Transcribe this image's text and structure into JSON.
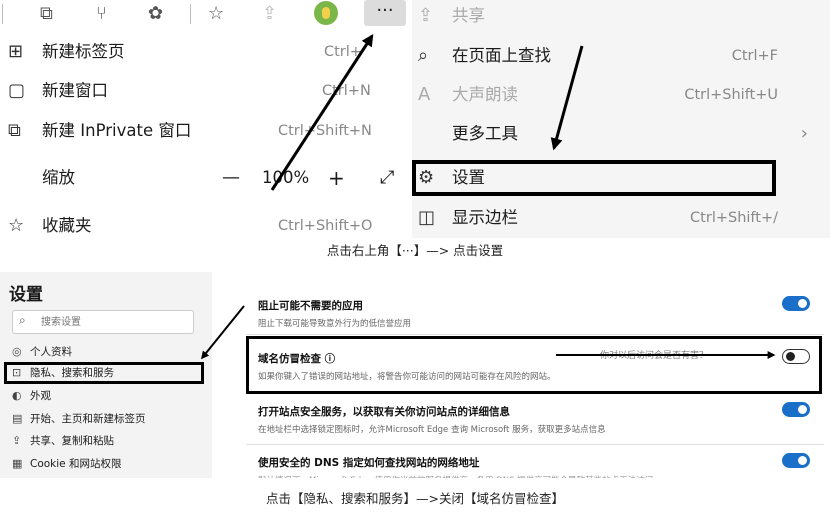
{
  "menu_left": {
    "items": [
      {
        "icon": "new-tab-icon",
        "glyph": "⊞",
        "label": "新建标签页",
        "shortcut": "Ctrl+"
      },
      {
        "icon": "new-window-icon",
        "glyph": "▢",
        "label": "新建窗口",
        "shortcut": "Ctrl+N"
      },
      {
        "icon": "inprivate-icon",
        "glyph": "⧉",
        "label": "新建 InPrivate 窗口",
        "shortcut": "Ctrl+Shift+N"
      },
      {
        "icon": "",
        "glyph": "",
        "label": "缩放",
        "shortcut": ""
      },
      {
        "icon": "favorites-icon",
        "glyph": "☆",
        "label": "收藏夹",
        "shortcut": "Ctrl+Shift+O"
      }
    ],
    "zoom": {
      "minus": "—",
      "value": "100%",
      "plus": "+",
      "expand": "⤢"
    }
  },
  "toolbar": {
    "more": "···"
  },
  "menu_right": {
    "items": [
      {
        "icon": "share-icon",
        "glyph": "⇪",
        "label": "共享",
        "shortcut": ""
      },
      {
        "icon": "find-icon",
        "glyph": "⌕",
        "label": "在页面上查找",
        "shortcut": "Ctrl+F"
      },
      {
        "icon": "read-aloud-icon",
        "glyph": "A",
        "label": "大声朗读",
        "shortcut": "Ctrl+Shift+U"
      },
      {
        "icon": "",
        "glyph": "",
        "label": "更多工具",
        "shortcut": "›"
      },
      {
        "icon": "settings-gear-icon",
        "glyph": "⚙",
        "label": "设置",
        "shortcut": ""
      },
      {
        "icon": "sidebar-icon",
        "glyph": "◫",
        "label": "显示边栏",
        "shortcut": "Ctrl+Shift+/"
      }
    ]
  },
  "caption1": "点击右上角【···】—> 点击设置",
  "settings": {
    "title": "设置",
    "search_placeholder": "搜索设置",
    "nav": [
      {
        "icon": "profile-icon",
        "glyph": "◎",
        "label": "个人资料"
      },
      {
        "icon": "privacy-lock-icon",
        "glyph": "🔒",
        "label": "隐私、搜索和服务"
      },
      {
        "icon": "appearance-icon",
        "glyph": "◐",
        "label": "外观"
      },
      {
        "icon": "start-page-icon",
        "glyph": "▤",
        "label": "开始、主页和新建标签页"
      },
      {
        "icon": "share-copy-icon",
        "glyph": "⇪",
        "label": "共享、复制和粘贴"
      },
      {
        "icon": "cookie-icon",
        "glyph": "▦",
        "label": "Cookie 和网站权限"
      }
    ],
    "rows": [
      {
        "title": "阻止可能不需要的应用",
        "desc": "阻止下载可能导致意外行为的低信誉应用",
        "on": true
      },
      {
        "title": "域名仿冒检查 ⓘ",
        "desc": "如果你键入了错误的网站地址，将警告你可能访问的网站可能存在风险的网站。",
        "on": false
      },
      {
        "title": "打开站点安全服务，以获取有关你访问站点的详细信息",
        "desc": "在地址栏中选择锁定图标时，允许Microsoft Edge 查询 Microsoft 服务，获取更多站点信息",
        "on": true
      },
      {
        "title": "使用安全的 DNS 指定如何查找网站的网络地址",
        "desc": "默认情况下，Microsoft Edge 使用你当前的服务提供商。备用 DNS 提供商可能会导致某些站点无法访问",
        "on": true
      }
    ],
    "note": "你对以后访问会是否有害？"
  },
  "caption2": "点击【隐私、搜索和服务】—>关闭【域名仿冒检查】",
  "colors": {
    "accent": "#1a6fc9",
    "highlight_box": "#000000"
  }
}
